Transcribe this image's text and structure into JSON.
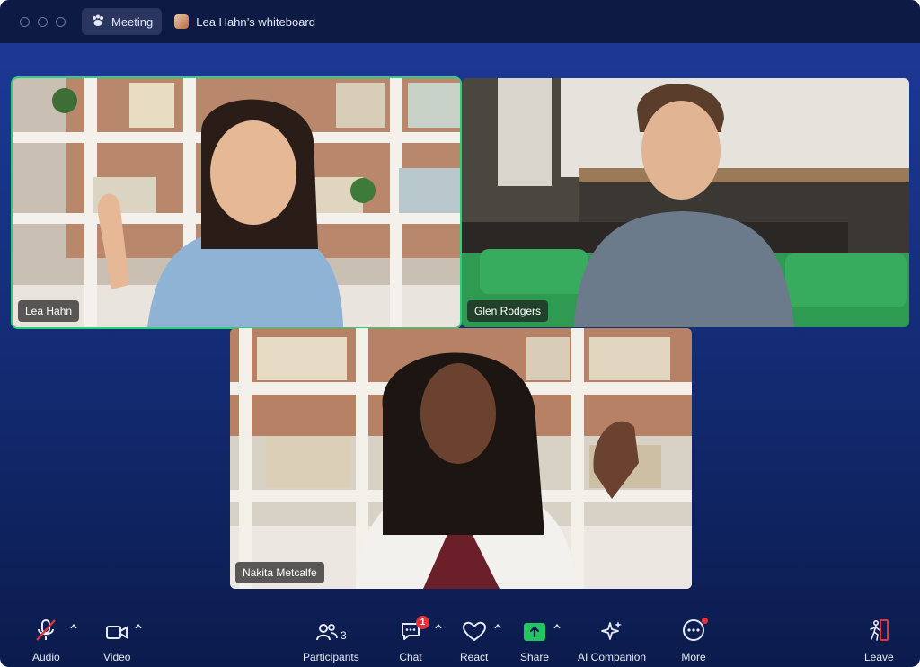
{
  "titlebar": {
    "meeting_tab": "Meeting",
    "whiteboard_tab": "Lea Hahn’s whiteboard"
  },
  "participants": [
    {
      "name": "Lea Hahn",
      "active_speaker": true
    },
    {
      "name": "Glen Rodgers",
      "active_speaker": false
    },
    {
      "name": "Nakita Metcalfe",
      "active_speaker": false
    }
  ],
  "toolbar": {
    "audio": "Audio",
    "video": "Video",
    "participants": "Participants",
    "participants_count": "3",
    "chat": "Chat",
    "chat_badge": "1",
    "react": "React",
    "share": "Share",
    "ai_companion": "AI Companion",
    "more": "More",
    "leave": "Leave"
  },
  "colors": {
    "share_green": "#22c55e",
    "badge_red": "#e5323b",
    "leave_red": "#e5323b",
    "active_border": "#2bd07a"
  }
}
